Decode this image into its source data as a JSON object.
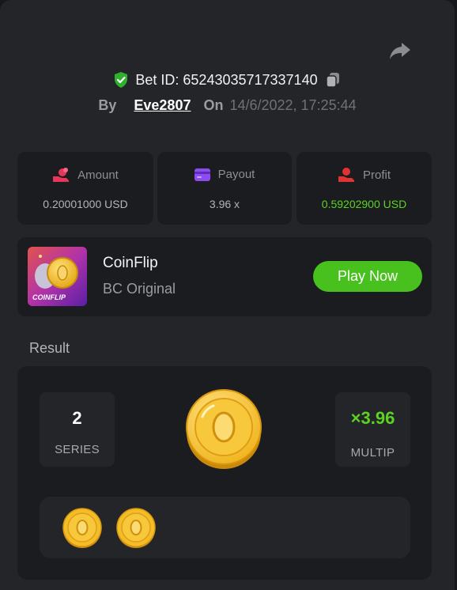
{
  "header": {
    "bet_id": "Bet ID: 65243035717337140",
    "by_label": "By",
    "username": "Eve2807",
    "on_label": "On",
    "timestamp": "14/6/2022, 17:25:44"
  },
  "stats": [
    {
      "label": "Amount",
      "value": "0.20001000 USD",
      "icon": "coins-hand-icon",
      "color": "#e8365a"
    },
    {
      "label": "Payout",
      "value": "3.96 x",
      "icon": "wallet-card-icon",
      "color": "#8c4cf0"
    },
    {
      "label": "Profit",
      "value": "0.59202900 USD",
      "icon": "profit-hand-icon",
      "color": "#e23333",
      "value_color": "#5cd221"
    }
  ],
  "game": {
    "name": "CoinFlip",
    "provider": "BC Original",
    "thumb_label": "COINFLIP",
    "play_label": "Play Now"
  },
  "result": {
    "title": "Result",
    "series_value": "2",
    "series_label": "SERIES",
    "multiplier_value": "×3.96",
    "multiplier_label": "MULTIP",
    "history_count": 2
  },
  "colors": {
    "accent_green": "#48c11f",
    "profit_green": "#5cd221",
    "panel": "#242528",
    "card": "#1b1c1f"
  }
}
